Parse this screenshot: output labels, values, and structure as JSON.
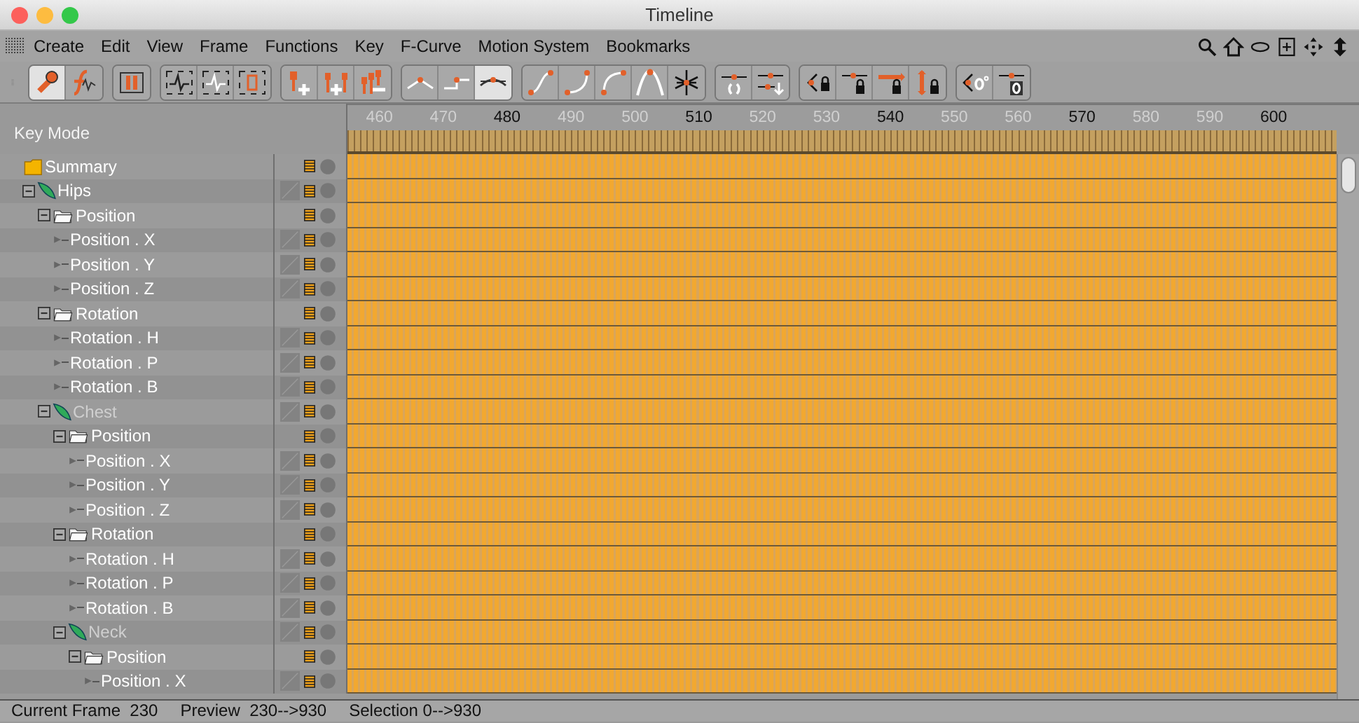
{
  "window": {
    "title": "Timeline"
  },
  "menu": [
    "Create",
    "Edit",
    "View",
    "Frame",
    "Functions",
    "Key",
    "F-Curve",
    "Motion System",
    "Bookmarks"
  ],
  "toolbar": [
    {
      "buttons": [
        {
          "selected": true
        },
        {
          "selected": false
        }
      ]
    },
    {
      "buttons": [
        {
          "selected": false
        }
      ]
    },
    {
      "buttons": [
        {
          "selected": false
        },
        {
          "selected": false
        },
        {
          "selected": false
        }
      ]
    },
    {
      "buttons": [
        {
          "selected": false
        },
        {
          "selected": false
        },
        {
          "selected": false
        }
      ]
    },
    {
      "buttons": [
        {
          "selected": false
        },
        {
          "selected": false
        },
        {
          "selected": true
        }
      ]
    },
    {
      "buttons": [
        {
          "selected": false
        },
        {
          "selected": false
        },
        {
          "selected": false
        },
        {
          "selected": false
        },
        {
          "selected": false
        }
      ]
    },
    {
      "buttons": [
        {
          "selected": false
        },
        {
          "selected": false
        }
      ]
    },
    {
      "buttons": [
        {
          "selected": false
        },
        {
          "selected": false
        },
        {
          "selected": false
        },
        {
          "selected": false
        }
      ]
    },
    {
      "buttons": [
        {
          "selected": false
        },
        {
          "selected": false
        }
      ]
    }
  ],
  "mode_label": "Key Mode",
  "ruler": [
    {
      "label": "460",
      "major": false
    },
    {
      "label": "470",
      "major": false
    },
    {
      "label": "480",
      "major": true
    },
    {
      "label": "490",
      "major": false
    },
    {
      "label": "500",
      "major": false
    },
    {
      "label": "510",
      "major": true
    },
    {
      "label": "520",
      "major": false
    },
    {
      "label": "530",
      "major": false
    },
    {
      "label": "540",
      "major": true
    },
    {
      "label": "550",
      "major": false
    },
    {
      "label": "560",
      "major": false
    },
    {
      "label": "570",
      "major": true
    },
    {
      "label": "580",
      "major": false
    },
    {
      "label": "590",
      "major": false
    },
    {
      "label": "600",
      "major": true
    }
  ],
  "tree": [
    {
      "kind": "summary",
      "label": "Summary"
    },
    {
      "kind": "object",
      "label": "Hips",
      "expanded": true,
      "dimmed": false,
      "children": [
        {
          "kind": "folder",
          "label": "Position",
          "expanded": true,
          "children": [
            {
              "kind": "track",
              "label": "Position . X"
            },
            {
              "kind": "track",
              "label": "Position . Y"
            },
            {
              "kind": "track",
              "label": "Position . Z"
            }
          ]
        },
        {
          "kind": "folder",
          "label": "Rotation",
          "expanded": true,
          "children": [
            {
              "kind": "track",
              "label": "Rotation . H"
            },
            {
              "kind": "track",
              "label": "Rotation . P"
            },
            {
              "kind": "track",
              "label": "Rotation . B"
            }
          ]
        },
        {
          "kind": "object",
          "label": "Chest",
          "expanded": true,
          "dimmed": true,
          "children": [
            {
              "kind": "folder",
              "label": "Position",
              "expanded": true,
              "children": [
                {
                  "kind": "track",
                  "label": "Position . X"
                },
                {
                  "kind": "track",
                  "label": "Position . Y"
                },
                {
                  "kind": "track",
                  "label": "Position . Z"
                }
              ]
            },
            {
              "kind": "folder",
              "label": "Rotation",
              "expanded": true,
              "children": [
                {
                  "kind": "track",
                  "label": "Rotation . H"
                },
                {
                  "kind": "track",
                  "label": "Rotation . P"
                },
                {
                  "kind": "track",
                  "label": "Rotation . B"
                }
              ]
            },
            {
              "kind": "object",
              "label": "Neck",
              "expanded": true,
              "dimmed": true,
              "children": [
                {
                  "kind": "folder",
                  "label": "Position",
                  "expanded": true,
                  "children": [
                    {
                      "kind": "track",
                      "label": "Position . X"
                    }
                  ]
                }
              ]
            }
          ]
        }
      ]
    }
  ],
  "status_bar": [
    "Current Frame  230",
    "Preview  230-->930",
    "Selection 0-->930"
  ]
}
